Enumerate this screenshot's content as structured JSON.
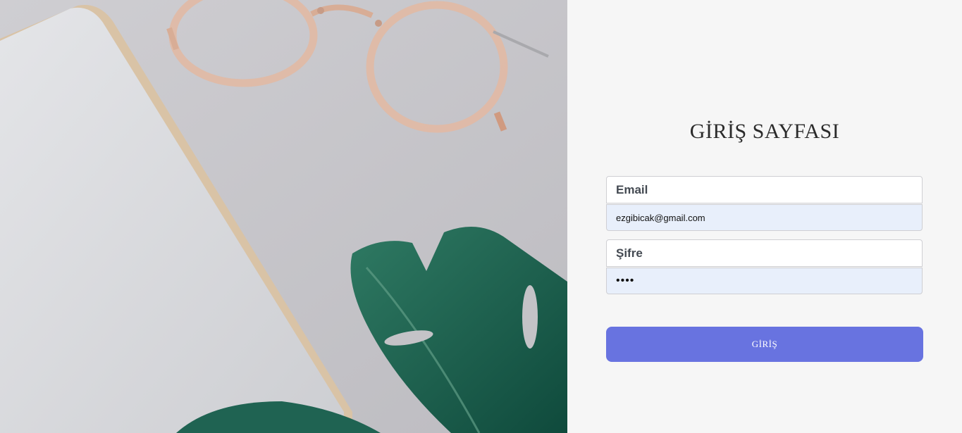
{
  "form": {
    "title": "GİRİŞ SAYFASI",
    "email_label": "Email",
    "email_value": "ezgibicak@gmail.com",
    "password_label": "Şifre",
    "password_value": "••••",
    "submit_label": "GİRİŞ"
  },
  "colors": {
    "background": "#f6f6f6",
    "input_fill": "#e8effb",
    "button": "#6873e0",
    "title": "#2b2b2b"
  }
}
